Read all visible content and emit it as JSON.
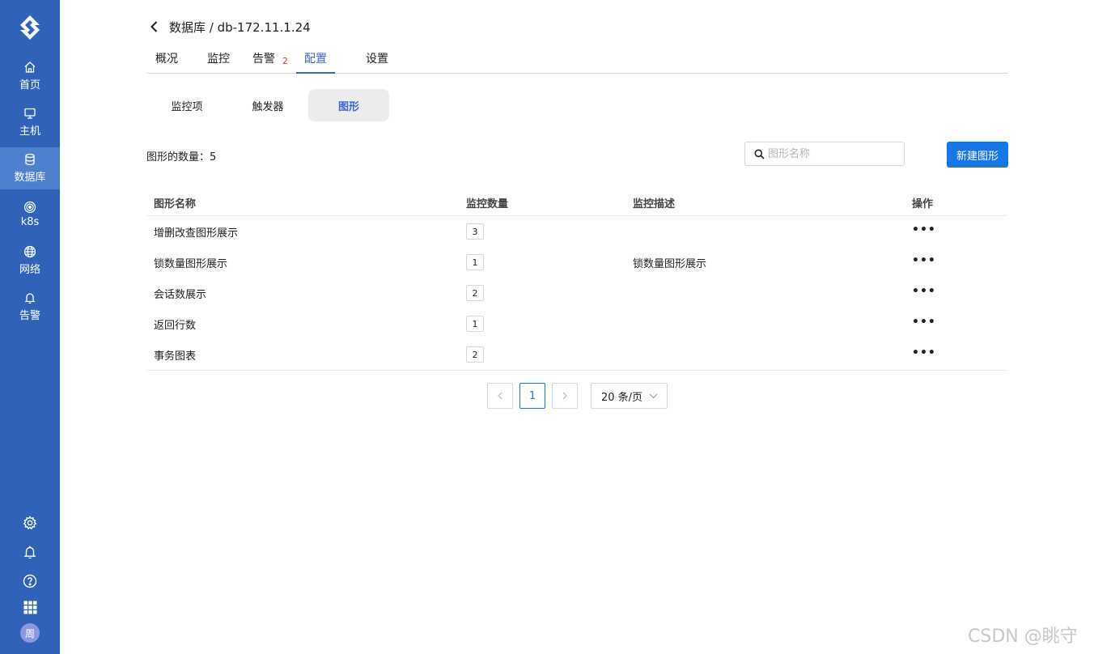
{
  "sidebar": {
    "items": [
      {
        "label": "首页",
        "icon": "home-icon"
      },
      {
        "label": "主机",
        "icon": "monitor-icon"
      },
      {
        "label": "数据库",
        "icon": "database-icon",
        "active": true
      },
      {
        "label": "k8s",
        "icon": "k8s-icon"
      },
      {
        "label": "网络",
        "icon": "globe-icon"
      },
      {
        "label": "告警",
        "icon": "bell-icon"
      }
    ],
    "avatar_text": "周",
    "colors": {
      "background": "#2f62b8",
      "active": "#4f7fcf"
    }
  },
  "header": {
    "breadcrumb": "数据库 / db-172.11.1.24"
  },
  "tabs": [
    {
      "label": "概况"
    },
    {
      "label": "监控"
    },
    {
      "label": "告警",
      "badge": "2"
    },
    {
      "label": "配置",
      "active": true
    },
    {
      "label": "设置"
    }
  ],
  "subtabs": [
    {
      "label": "监控项"
    },
    {
      "label": "触发器"
    },
    {
      "label": "图形",
      "active": true
    }
  ],
  "toolbar": {
    "count_label": "图形的数量：5",
    "search_placeholder": "图形名称",
    "search_value": "",
    "new_button": "新建图形"
  },
  "table": {
    "columns": [
      "图形名称",
      "监控数量",
      "监控描述",
      "操作"
    ],
    "rows": [
      {
        "name": "增删改查图形展示",
        "count": "3",
        "desc": "",
        "action": "•••"
      },
      {
        "name": "锁数量图形展示",
        "count": "1",
        "desc": "锁数量图形展示",
        "action": "•••"
      },
      {
        "name": "会话数展示",
        "count": "2",
        "desc": "",
        "action": "•••"
      },
      {
        "name": "返回行数",
        "count": "1",
        "desc": "",
        "action": "•••"
      },
      {
        "name": "事务图表",
        "count": "2",
        "desc": "",
        "action": "•••"
      }
    ]
  },
  "pagination": {
    "prev": "<",
    "current_page": "1",
    "next": ">",
    "page_size": "20 条/页"
  },
  "watermark": "CSDN @眺守",
  "colors": {
    "primary": "#1677e8",
    "tab_active": "#3b63d1",
    "badge": "#e03a3a"
  }
}
